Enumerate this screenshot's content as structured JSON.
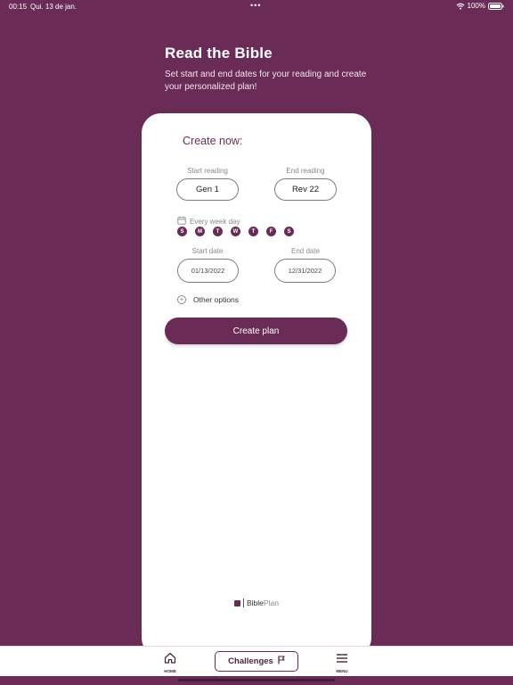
{
  "status_bar": {
    "time": "00:15",
    "date": "Qui. 13 de jan.",
    "dots": "•••",
    "battery": "100%"
  },
  "header": {
    "title": "Read the Bible",
    "subtitle": "Set start and end dates for your reading and create your personalized plan!"
  },
  "card": {
    "heading": "Create now:",
    "start_reading_label": "Start reading",
    "start_reading_value": "Gen 1",
    "end_reading_label": "End reading",
    "end_reading_value": "Rev 22",
    "week_label": "Every week day",
    "days": [
      "S",
      "M",
      "T",
      "W",
      "T",
      "F",
      "S"
    ],
    "start_date_label": "Start date",
    "start_date_value": "01/13/2022",
    "end_date_label": "End date",
    "end_date_value": "12/31/2022",
    "other_options": "Other options",
    "create_button": "Create plan"
  },
  "logo": {
    "bible": "Bible",
    "plan": "Plan"
  },
  "tabbar": {
    "home": "HOME",
    "challenges": "Challenges",
    "menu": "MENU"
  },
  "colors": {
    "brand": "#6a2c57",
    "card": "#ffffff"
  },
  "icons": {
    "home": "home-icon",
    "flag": "flag-icon",
    "menu": "hamburger-icon",
    "calendar": "calendar-icon",
    "plus": "plus-circle-icon",
    "wifi": "wifi-icon",
    "battery": "battery-icon"
  }
}
